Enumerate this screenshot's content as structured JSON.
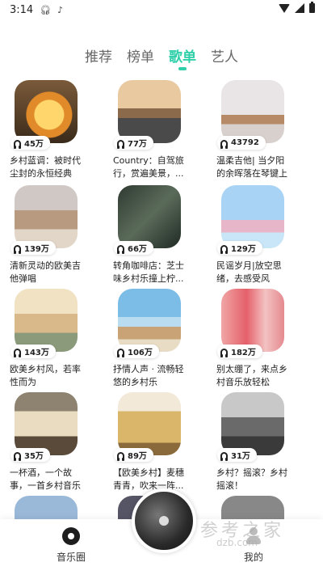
{
  "status_bar": {
    "time": "3:14",
    "icons": [
      "headset-icon",
      "tiktok-icon",
      "wifi-icon",
      "signal-icon",
      "battery-icon"
    ]
  },
  "tabs": [
    {
      "label": "推荐",
      "active": false
    },
    {
      "label": "榜单",
      "active": false
    },
    {
      "label": "歌单",
      "active": true
    },
    {
      "label": "艺人",
      "active": false
    }
  ],
  "accent_color": "#2ecfa9",
  "playlists": [
    {
      "count": "45万",
      "title": "乡村蓝调：被时代尘封的永恒经典"
    },
    {
      "count": "77万",
      "title": "Country：自驾旅行，赏遍美景，..."
    },
    {
      "count": "43792",
      "title": "温柔吉他| 当夕阳的余晖落在琴键上"
    },
    {
      "count": "139万",
      "title": "清新灵动的欧美吉他弹唱"
    },
    {
      "count": "66万",
      "title": "转角咖啡店：芝士味乡村乐撞上柠..."
    },
    {
      "count": "129万",
      "title": "民谣岁月|放空思绪，去感受风"
    },
    {
      "count": "143万",
      "title": "欧美乡村风，若率性而为"
    },
    {
      "count": "106万",
      "title": "抒情人声 · 流畅轻悠的乡村乐"
    },
    {
      "count": "182万",
      "title": "别太绷了，来点乡村音乐放轻松"
    },
    {
      "count": "35万",
      "title": "一杯酒，一个故事，一首乡村音乐"
    },
    {
      "count": "89万",
      "title": "【欧美乡村】麦穗青青，吹来一阵..."
    },
    {
      "count": "31万",
      "title": "乡村？摇滚？乡村摇滚！"
    },
    {
      "count": "",
      "title": ""
    },
    {
      "count": "",
      "title": ""
    },
    {
      "count": "",
      "title": ""
    }
  ],
  "bottom_nav": {
    "left_label": "音乐圈",
    "right_label": "我的"
  },
  "watermark": {
    "text": "参考之家",
    "url_text": "dzb.com"
  }
}
